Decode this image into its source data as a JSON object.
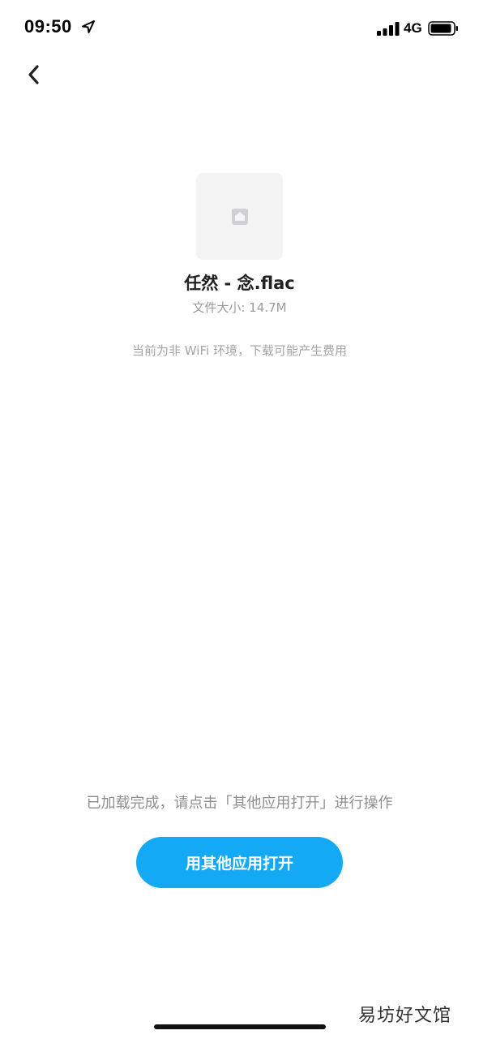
{
  "status_bar": {
    "time": "09:50",
    "network": "4G",
    "location_icon": "location-arrow-icon",
    "signal_icon": "cellular-signal-icon",
    "battery_icon": "battery-icon"
  },
  "nav": {
    "back_icon": "chevron-left-icon"
  },
  "file": {
    "icon": "image-file-icon",
    "name": "任然 - 念.flac",
    "size_label": "文件大小: ",
    "size_value": "14.7M",
    "network_warning": "当前为非 WiFi 环境，下载可能产生费用"
  },
  "footer": {
    "hint": "已加载完成，请点击「其他应用打开」进行操作",
    "open_button_label": "用其他应用打开",
    "watermark": "易坊好文馆"
  },
  "colors": {
    "accent": "#14a9f4",
    "background": "#ffffff",
    "muted_text": "#9a9a9a"
  }
}
